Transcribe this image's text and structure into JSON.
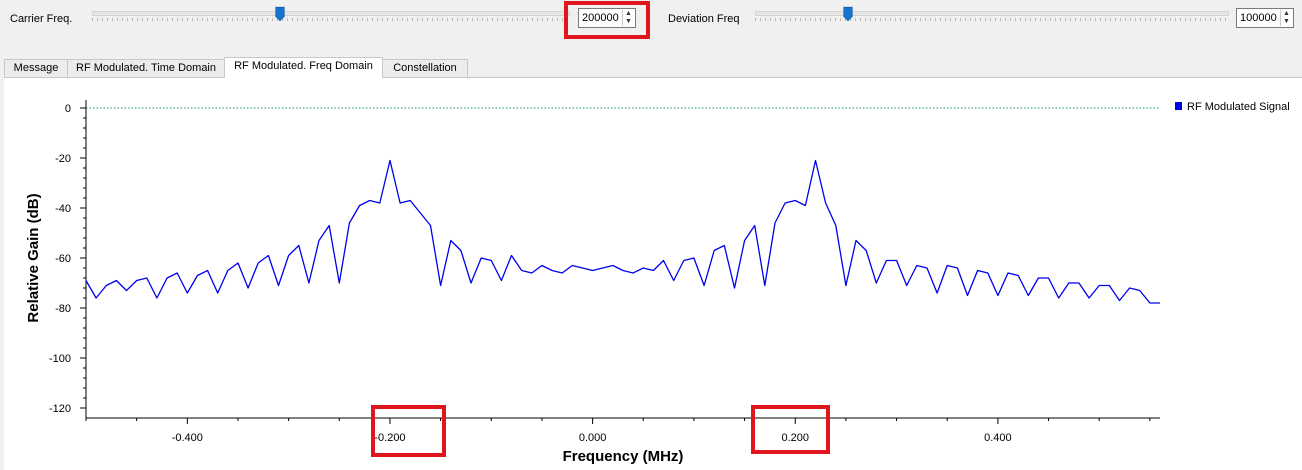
{
  "controls": {
    "carrier": {
      "label": "Carrier Freq.",
      "value": "200000",
      "slider_fraction": 0.39
    },
    "deviation": {
      "label": "Deviation Freq",
      "value": "100000",
      "slider_fraction": 0.2
    }
  },
  "tabs": [
    {
      "label": "Message",
      "active": false
    },
    {
      "label": "RF Modulated. Time Domain",
      "active": false
    },
    {
      "label": "RF Modulated. Freq Domain",
      "active": true
    },
    {
      "label": "Constellation",
      "active": false
    }
  ],
  "chart_data": {
    "type": "line",
    "xlabel": "Frequency (MHz)",
    "ylabel": "Relative Gain (dB)",
    "xlim": [
      -0.5,
      0.56
    ],
    "ylim": [
      -120,
      0
    ],
    "xticks": [
      -0.4,
      -0.2,
      0.0,
      0.2,
      0.4
    ],
    "xtick_labels": [
      "-0.400",
      "-0.200",
      "0.000",
      "0.200",
      "0.400"
    ],
    "yticks": [
      0,
      -20,
      -40,
      -60,
      -80,
      -100,
      -120
    ],
    "ytick_labels": [
      "0",
      "-20",
      "-40",
      "-60",
      "-80",
      "-100",
      "-120"
    ],
    "grid": false,
    "legend_position": "top-right",
    "reference_line": {
      "y": 0,
      "style": "dotted",
      "color": "#0a8a7a"
    },
    "series": [
      {
        "name": "RF Modulated Signal",
        "color": "#0000ee",
        "x": [
          -0.5,
          -0.49,
          -0.48,
          -0.47,
          -0.46,
          -0.45,
          -0.44,
          -0.43,
          -0.42,
          -0.41,
          -0.4,
          -0.39,
          -0.38,
          -0.37,
          -0.36,
          -0.35,
          -0.34,
          -0.33,
          -0.32,
          -0.31,
          -0.3,
          -0.29,
          -0.28,
          -0.27,
          -0.26,
          -0.25,
          -0.24,
          -0.23,
          -0.22,
          -0.21,
          -0.2,
          -0.19,
          -0.18,
          -0.17,
          -0.16,
          -0.15,
          -0.14,
          -0.13,
          -0.12,
          -0.11,
          -0.1,
          -0.09,
          -0.08,
          -0.07,
          -0.06,
          -0.05,
          -0.04,
          -0.03,
          -0.02,
          -0.01,
          0.0,
          0.01,
          0.02,
          0.03,
          0.04,
          0.05,
          0.06,
          0.07,
          0.08,
          0.09,
          0.1,
          0.11,
          0.12,
          0.13,
          0.14,
          0.15,
          0.16,
          0.17,
          0.18,
          0.19,
          0.2,
          0.21,
          0.22,
          0.23,
          0.24,
          0.25,
          0.26,
          0.27,
          0.28,
          0.29,
          0.3,
          0.31,
          0.32,
          0.33,
          0.34,
          0.35,
          0.36,
          0.37,
          0.38,
          0.39,
          0.4,
          0.41,
          0.42,
          0.43,
          0.44,
          0.45,
          0.46,
          0.47,
          0.48,
          0.49,
          0.5,
          0.51,
          0.52,
          0.53,
          0.54,
          0.55,
          0.56
        ],
        "y": [
          -69,
          -76,
          -71,
          -69,
          -73,
          -69,
          -68,
          -76,
          -68,
          -66,
          -74,
          -67,
          -65,
          -74,
          -65,
          -62,
          -72,
          -62,
          -59,
          -71,
          -59,
          -55,
          -70,
          -53,
          -47,
          -70,
          -46,
          -39,
          -37,
          -38,
          -21,
          -38,
          -37,
          -42,
          -47,
          -71,
          -53,
          -57,
          -70,
          -60,
          -61,
          -69,
          -59,
          -65,
          -66,
          -63,
          -65,
          -66,
          -63,
          -64,
          -65,
          -64,
          -63,
          -65,
          -66,
          -64,
          -65,
          -61,
          -69,
          -61,
          -60,
          -71,
          -57,
          -55,
          -72,
          -53,
          -47,
          -71,
          -46,
          -38,
          -37,
          -39,
          -21,
          -38,
          -47,
          -71,
          -53,
          -57,
          -70,
          -61,
          -61,
          -71,
          -63,
          -64,
          -74,
          -63,
          -64,
          -75,
          -65,
          -66,
          -75,
          -66,
          -67,
          -75,
          -68,
          -68,
          -76,
          -70,
          -70,
          -76,
          -71,
          -71,
          -77,
          -72,
          -73,
          -78,
          -78
        ]
      }
    ]
  }
}
